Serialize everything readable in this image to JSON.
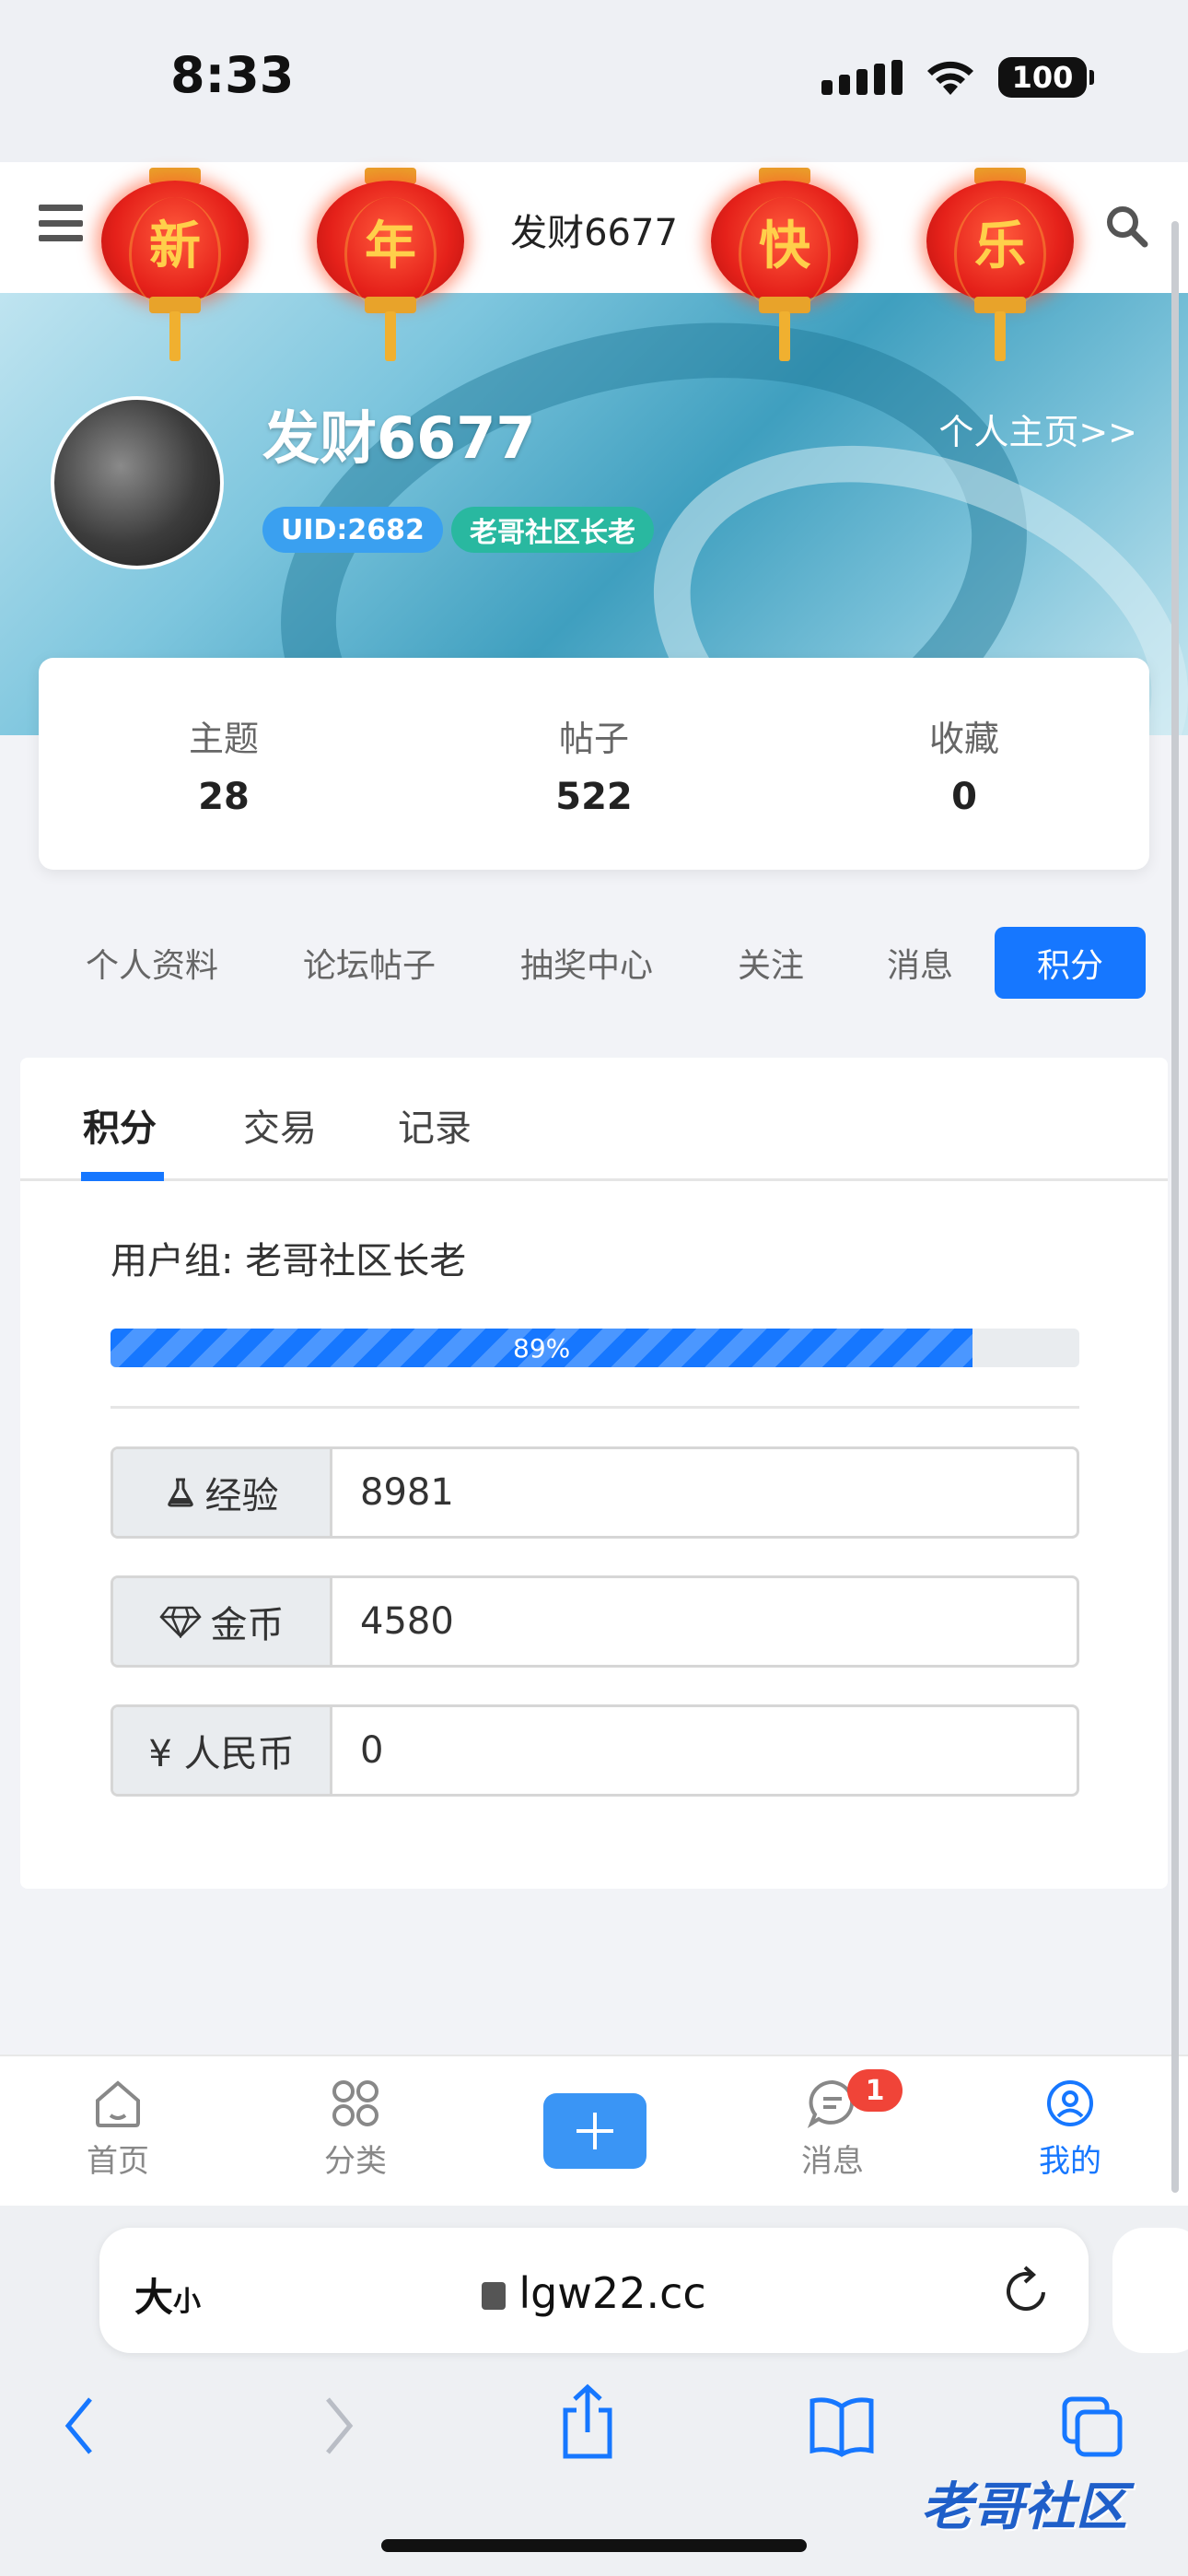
{
  "status_bar": {
    "time": "8:33",
    "battery": "100"
  },
  "top_bar": {
    "title": "发财6677",
    "lanterns": [
      "新",
      "年",
      "快",
      "乐"
    ]
  },
  "profile": {
    "username": "发财6677",
    "homepage_link": "个人主页>>",
    "uid_badge": "UID:2682",
    "group_badge": "老哥社区长老"
  },
  "stats": [
    {
      "label": "主题",
      "value": "28"
    },
    {
      "label": "帖子",
      "value": "522"
    },
    {
      "label": "收藏",
      "value": "0"
    }
  ],
  "nav_pills": [
    "个人资料",
    "论坛帖子",
    "抽奖中心",
    "关注",
    "消息",
    "积分"
  ],
  "tabs": [
    "积分",
    "交易",
    "记录"
  ],
  "credits": {
    "user_group": "用户组: 老哥社区长老",
    "progress_percent": 89,
    "progress_label": "89%",
    "fields": [
      {
        "icon": "flask-icon",
        "label": "经验",
        "value": "8981"
      },
      {
        "icon": "diamond-icon",
        "label": "金币",
        "value": "4580"
      },
      {
        "icon": "yen-icon",
        "label": "¥ 人民币",
        "value": "0"
      }
    ]
  },
  "tabbar": {
    "items": [
      "首页",
      "分类",
      "消息",
      "我的"
    ],
    "message_badge": "1"
  },
  "browser": {
    "text_size_label": "大",
    "text_size_small": "小",
    "url": "lgw22.cc"
  },
  "watermark": "老哥社区",
  "colors": {
    "accent": "#1677ff",
    "badge_red": "#f04438",
    "lantern_red": "#e5211a"
  }
}
